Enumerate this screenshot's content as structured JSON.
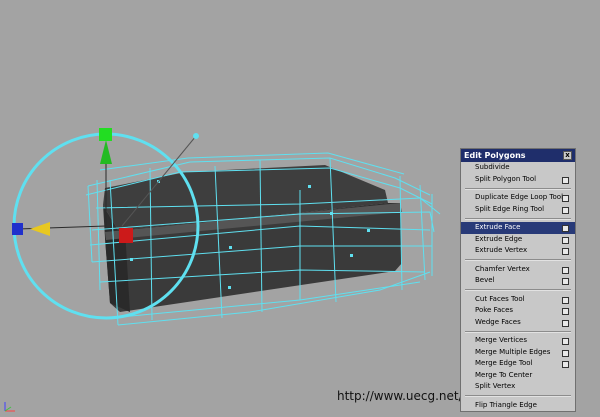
{
  "menu": {
    "title": "Edit Polygons",
    "close": "x",
    "groups": [
      [
        {
          "label": "Subdivide",
          "opt": false
        },
        {
          "label": "Split Polygon Tool",
          "opt": true
        }
      ],
      [
        {
          "label": "Duplicate Edge Loop Tool",
          "opt": true
        },
        {
          "label": "Split Edge Ring Tool",
          "opt": true
        }
      ],
      [
        {
          "label": "Extrude Face",
          "opt": true,
          "highlighted": true
        },
        {
          "label": "Extrude Edge",
          "opt": true
        },
        {
          "label": "Extrude Vertex",
          "opt": true
        }
      ],
      [
        {
          "label": "Chamfer Vertex",
          "opt": true
        },
        {
          "label": "Bevel",
          "opt": true
        }
      ],
      [
        {
          "label": "Cut Faces Tool",
          "opt": true
        },
        {
          "label": "Poke Faces",
          "opt": true
        },
        {
          "label": "Wedge Faces",
          "opt": true
        }
      ],
      [
        {
          "label": "Merge Vertices",
          "opt": true
        },
        {
          "label": "Merge Multiple Edges",
          "opt": true
        },
        {
          "label": "Merge Edge Tool",
          "opt": true
        },
        {
          "label": "Merge To Center",
          "opt": false
        },
        {
          "label": "Split Vertex",
          "opt": false
        }
      ],
      [
        {
          "label": "Flip Triangle Edge",
          "opt": false
        }
      ]
    ]
  },
  "watermark": "http://www.uecg.net/",
  "colors": {
    "background": "#a3a3a3",
    "wire": "#5fe0f0",
    "menu_highlight": "#283a78",
    "menu_title": "#1f2e6b"
  }
}
